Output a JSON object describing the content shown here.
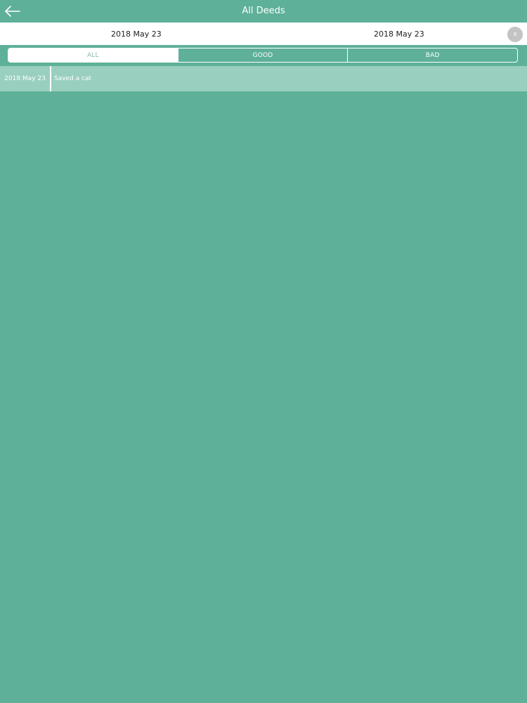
{
  "header": {
    "title": "All Deeds",
    "back_icon": "arrow-left-icon"
  },
  "date_range": {
    "from": "2018 May 23",
    "to": "2018 May 23",
    "clear_label": "x"
  },
  "filter": {
    "tabs": [
      {
        "label": "ALL",
        "active": true
      },
      {
        "label": "GOOD",
        "active": false
      },
      {
        "label": "BAD",
        "active": false
      }
    ]
  },
  "deeds": [
    {
      "date": "2018 May 23",
      "text": "Saved a cat"
    }
  ],
  "colors": {
    "background": "#5eb098",
    "row": "#99cfbe",
    "active_tab_text": "#8db9ac",
    "clear_button": "#c4c4c4"
  }
}
